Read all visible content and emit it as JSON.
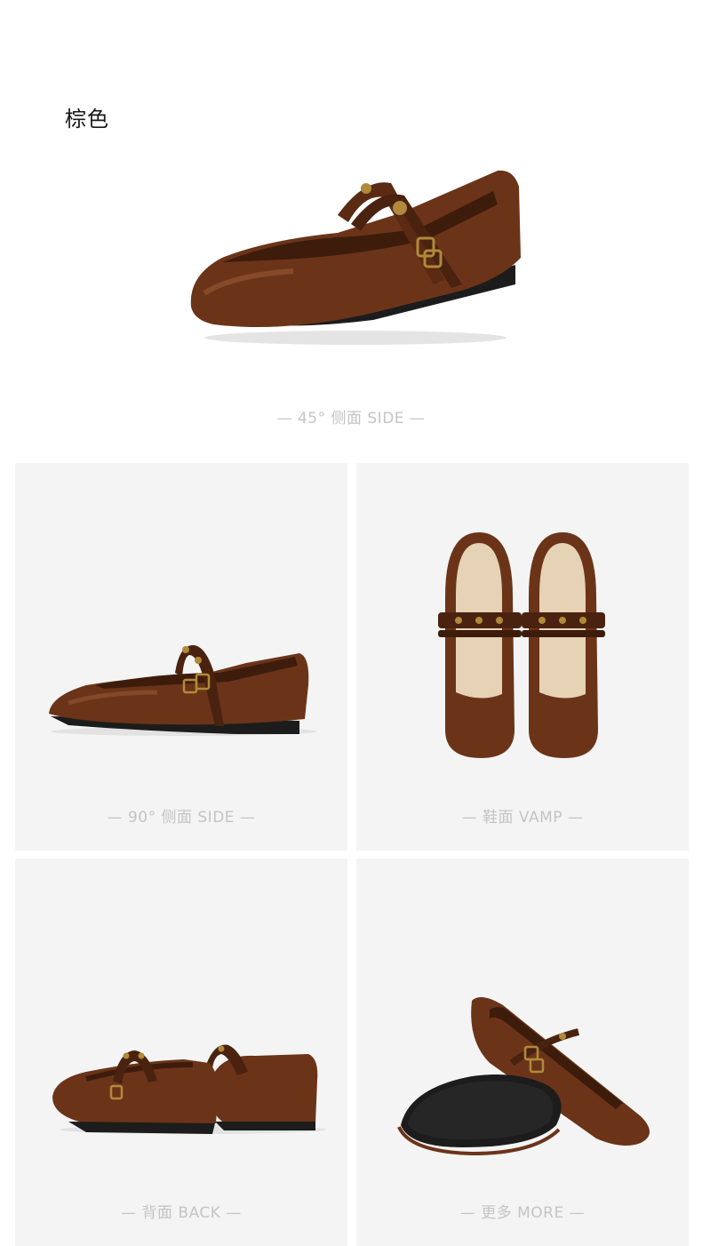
{
  "color_name": "棕色",
  "views": [
    {
      "id": "angle45",
      "caption": "— 45°  侧面 SIDE —"
    },
    {
      "id": "side90",
      "caption": "— 90°  侧面 SIDE —"
    },
    {
      "id": "vamp",
      "caption": "— 鞋面 VAMP —"
    },
    {
      "id": "back",
      "caption": "— 背面 BACK —"
    },
    {
      "id": "more",
      "caption": "— 更多 MORE —"
    }
  ],
  "colors": {
    "leather": "#6b3419",
    "leather_dark": "#4a2210",
    "leather_light": "#8a4a28",
    "lining": "#e6d2b4",
    "sole": "#1c1c1c",
    "metal": "#b08a3a",
    "panel_bg": "#f4f4f4",
    "caption": "#c4c4c4"
  }
}
